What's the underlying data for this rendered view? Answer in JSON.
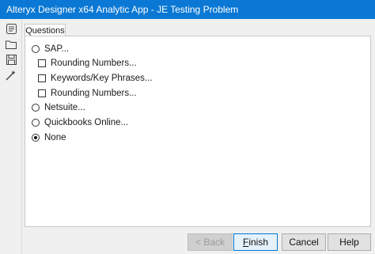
{
  "window": {
    "title": "Alteryx Designer x64 Analytic App - JE Testing Problem",
    "accent": "#0a78d4"
  },
  "toolbar": {
    "icons": [
      "interface-icon",
      "folder-icon",
      "save-icon",
      "magic-wand-icon"
    ]
  },
  "tabs": [
    {
      "label": "Questions",
      "selected": true
    }
  ],
  "questions": {
    "sap": {
      "label": "SAP...",
      "checked": false
    },
    "sap_options": [
      {
        "label": "Rounding Numbers...",
        "checked": false
      },
      {
        "label": "Keywords/Key Phrases...",
        "checked": false
      },
      {
        "label": "Rounding Numbers...",
        "checked": false
      }
    ],
    "netsuite": {
      "label": "Netsuite...",
      "checked": false
    },
    "quickbooks": {
      "label": "Quickbooks Online...",
      "checked": false
    },
    "none": {
      "label": "None",
      "checked": true
    }
  },
  "buttons": {
    "back": {
      "label": "< Back",
      "enabled": false
    },
    "finish": {
      "label_underlined": "F",
      "label_rest": "inish"
    },
    "cancel": {
      "label": "Cancel"
    },
    "help": {
      "label": "Help"
    }
  }
}
